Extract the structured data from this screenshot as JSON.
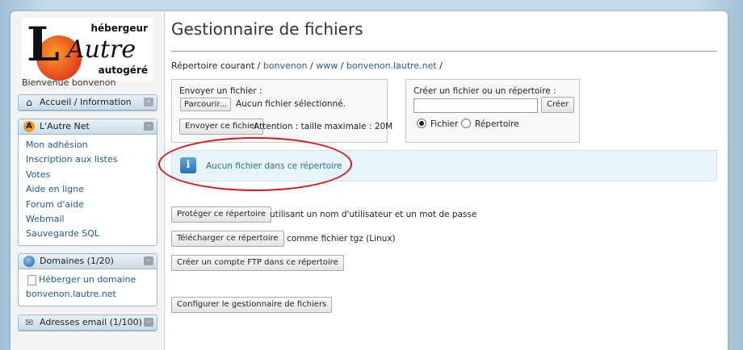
{
  "logo": {
    "top_text": "hébergeur",
    "bottom_text": "autogéré",
    "brand": "L'Autre"
  },
  "sidebar": {
    "welcome": "Bienvenue bonvenon",
    "accueil": {
      "label": "Accueil / Information",
      "icon": "home-icon"
    },
    "lautrenet": {
      "label": "L'Autre Net",
      "icon": "anarchy-icon",
      "items": [
        "Mon adhésion",
        "Inscription aux listes",
        "Votes",
        "Aide en ligne",
        "Forum d'aide",
        "Webmail",
        "Sauvegarde SQL"
      ]
    },
    "domaines": {
      "label": "Domaines (1/20)",
      "icon": "globe-icon",
      "items": [
        "Héberger un domaine",
        "bonvenon.lautre.net"
      ]
    },
    "email": {
      "label": "Adresses email (1/100)",
      "icon": "envelope-icon"
    }
  },
  "main": {
    "title": "Gestionnaire de fichiers",
    "crumb_label": "Répertoire courant /",
    "crumbs": [
      "bonvenon",
      "www",
      "bonvenon.lautre.net"
    ],
    "sep": "/",
    "upload": {
      "label": "Envoyer un fichier :",
      "browse": "Parcourir...",
      "no_file": "Aucun fichier sélectionné.",
      "send": "Envoyer ce fichier",
      "note": "Attention : taille maximale : 20M"
    },
    "create": {
      "label": "Créer un fichier ou un répertoire :",
      "value": "",
      "button": "Créer",
      "opt_file": "Fichier",
      "opt_dir": "Répertoire",
      "selected": "Fichier"
    },
    "info_msg": "Aucun fichier dans ce répertoire",
    "actions": {
      "protect": "Protéger ce répertoire",
      "protect_note": "utilisant un nom d'utilisateur et un mot de passe",
      "download": "Télécharger ce répertoire",
      "download_note": "comme fichier tgz (Linux)",
      "ftp": "Créer un compte FTP dans ce répertoire",
      "config": "Configurer le gestionnaire de fichiers"
    }
  },
  "colors": {
    "link": "#1d5a93",
    "annotation": "#d9171f",
    "info_bg": "#e7f4f9"
  }
}
